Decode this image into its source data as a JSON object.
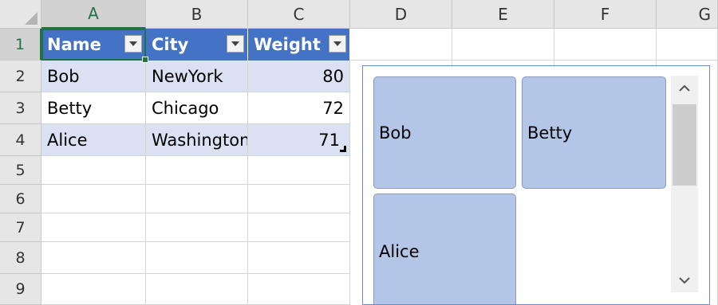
{
  "columns": [
    "A",
    "B",
    "C",
    "D",
    "E",
    "F",
    "G"
  ],
  "rows": [
    "1",
    "2",
    "3",
    "4",
    "5",
    "6",
    "7",
    "8",
    "9"
  ],
  "table": {
    "headers": [
      "Name",
      "City",
      "Weight"
    ],
    "rows": [
      {
        "name": "Bob",
        "city": "NewYork",
        "weight": "80"
      },
      {
        "name": "Betty",
        "city": "Chicago",
        "weight": "72"
      },
      {
        "name": "Alice",
        "city": "Washington",
        "weight": "71"
      }
    ]
  },
  "slicer": {
    "items": [
      "Bob",
      "Betty",
      "Alice"
    ]
  },
  "colors": {
    "table_header": "#4472c4",
    "band": "#d9e1f2",
    "slicer_item": "#b4c6e7",
    "selection": "#217346"
  }
}
